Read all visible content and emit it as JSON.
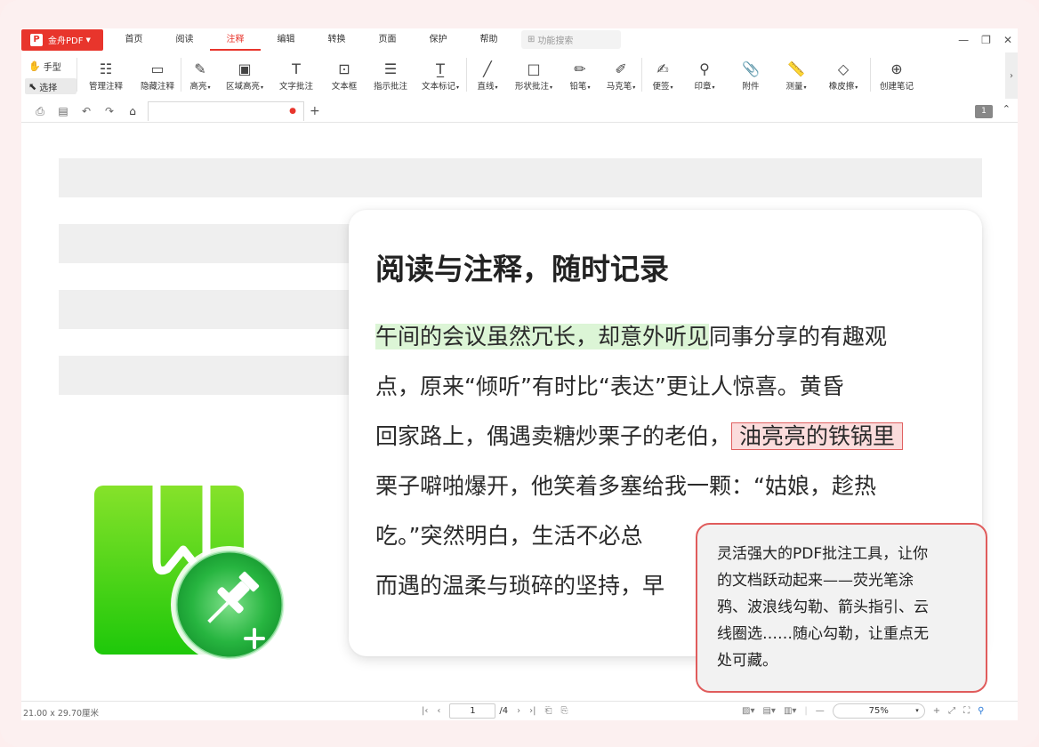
{
  "app": {
    "name": "金舟PDF",
    "logo": "P"
  },
  "menu": {
    "tabs": [
      "首页",
      "阅读",
      "注释",
      "编辑",
      "转换",
      "页面",
      "保护",
      "帮助"
    ],
    "active_tab": "注释",
    "search_placeholder": "功能搜索"
  },
  "ribbon": {
    "hand_tool": "手型",
    "select_tool": "选择",
    "tools": [
      {
        "label": "管理注释",
        "icon": "manage-annotations-icon"
      },
      {
        "label": "隐藏注释",
        "icon": "hide-annotations-icon"
      },
      {
        "label": "高亮",
        "icon": "highlight-icon",
        "dropdown": true
      },
      {
        "label": "区域高亮",
        "icon": "area-highlight-icon",
        "dropdown": true
      },
      {
        "label": "文字批注",
        "icon": "text-annotation-icon"
      },
      {
        "label": "文本框",
        "icon": "textbox-icon"
      },
      {
        "label": "指示批注",
        "icon": "callout-icon"
      },
      {
        "label": "文本标记",
        "icon": "text-markup-icon",
        "dropdown": true
      },
      {
        "label": "直线",
        "icon": "line-icon",
        "dropdown": true
      },
      {
        "label": "形状批注",
        "icon": "shape-icon",
        "dropdown": true
      },
      {
        "label": "铅笔",
        "icon": "pencil-icon",
        "dropdown": true
      },
      {
        "label": "马克笔",
        "icon": "marker-icon",
        "dropdown": true
      },
      {
        "label": "便签",
        "icon": "note-icon",
        "dropdown": true
      },
      {
        "label": "印章",
        "icon": "stamp-icon",
        "dropdown": true
      },
      {
        "label": "附件",
        "icon": "attachment-icon"
      },
      {
        "label": "测量",
        "icon": "measure-icon",
        "dropdown": true
      },
      {
        "label": "橡皮擦",
        "icon": "eraser-icon",
        "dropdown": true
      },
      {
        "label": "创建笔记",
        "icon": "create-note-icon"
      }
    ]
  },
  "quickbar": {
    "page_badge": "1"
  },
  "document": {
    "title": "阅读与注释，随时记录",
    "lines": [
      {
        "green": "午间的会议虽然冗长，却意外听见",
        "rest": "同事分享的有趣观"
      },
      {
        "text": "点，原来“倾听”有时比“表达”更让人惊喜。黄昏"
      },
      {
        "text": "回家路上，偶遇卖糖炒栗子的老伯，",
        "red": "油亮亮的铁锅里"
      },
      {
        "text": "栗子噼啪爆开，他笑着多塞给我一颗：“姑娘，趁热"
      },
      {
        "text": "吃。”突然明白，生活不必总"
      },
      {
        "text": "而遇的温柔与琐碎的坚持，早"
      }
    ],
    "bubble_lines": [
      "灵活强大的PDF批注工具，让你",
      "的文档跃动起来——荧光笔涂",
      "鸦、波浪线勾勒、箭头指引、云",
      "线圈选……随心勾勒，让重点无",
      "处可藏。"
    ]
  },
  "status": {
    "page_size": "21.00 x 29.70厘米",
    "current_page": "1",
    "total_pages": "/4",
    "zoom": "75%"
  },
  "colors": {
    "accent": "#e8352c",
    "highlight_green": "#dcf5d6",
    "highlight_red": "#fbdcdc",
    "bubble_border": "#e05c5c"
  }
}
